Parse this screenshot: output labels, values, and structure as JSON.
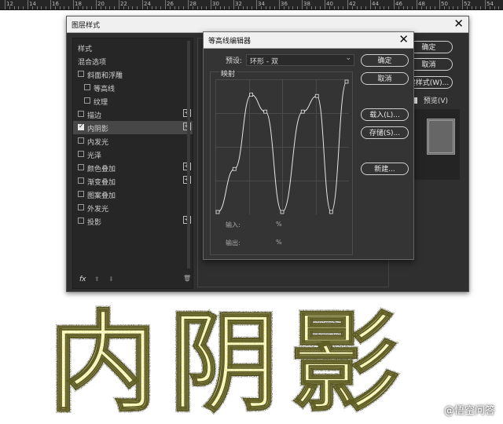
{
  "ruler": {
    "numbers": [
      "12",
      "14",
      "16",
      "18",
      "20",
      "22",
      "24",
      "26",
      "28",
      "30",
      "32",
      "34",
      "36",
      "38",
      "40",
      "42",
      "44",
      "46",
      "48",
      "50",
      "52",
      "54"
    ]
  },
  "layer_style_dialog": {
    "title": "图层样式",
    "close_glyph": "✕",
    "items": [
      {
        "label": "样式",
        "checkbox": false,
        "checked": false,
        "plus": false,
        "indent": 0
      },
      {
        "label": "混合选项",
        "checkbox": false,
        "checked": false,
        "plus": false,
        "indent": 0
      },
      {
        "label": "斜面和浮雕",
        "checkbox": true,
        "checked": false,
        "plus": false,
        "indent": 0
      },
      {
        "label": "等高线",
        "checkbox": true,
        "checked": false,
        "plus": false,
        "indent": 1
      },
      {
        "label": "纹理",
        "checkbox": true,
        "checked": false,
        "plus": false,
        "indent": 1
      },
      {
        "label": "描边",
        "checkbox": true,
        "checked": false,
        "plus": true,
        "indent": 0
      },
      {
        "label": "内阴影",
        "checkbox": true,
        "checked": true,
        "plus": true,
        "indent": 0,
        "selected": true
      },
      {
        "label": "内发光",
        "checkbox": true,
        "checked": false,
        "plus": false,
        "indent": 0
      },
      {
        "label": "光泽",
        "checkbox": true,
        "checked": false,
        "plus": false,
        "indent": 0
      },
      {
        "label": "颜色叠加",
        "checkbox": true,
        "checked": false,
        "plus": true,
        "indent": 0
      },
      {
        "label": "渐变叠加",
        "checkbox": true,
        "checked": false,
        "plus": true,
        "indent": 0
      },
      {
        "label": "图案叠加",
        "checkbox": true,
        "checked": false,
        "plus": false,
        "indent": 0
      },
      {
        "label": "外发光",
        "checkbox": true,
        "checked": false,
        "plus": false,
        "indent": 0
      },
      {
        "label": "投影",
        "checkbox": true,
        "checked": false,
        "plus": true,
        "indent": 0
      }
    ],
    "footer": {
      "fx": "fx",
      "up": "⬆",
      "down": "⬇",
      "trash": "🗑"
    },
    "buttons": {
      "ok": "确定",
      "cancel": "取消",
      "new_style": "建样式(W)..."
    },
    "preview_label": "预览(V)",
    "preview_checked": true
  },
  "contour_editor": {
    "title": "等高线编辑器",
    "close_glyph": "✕",
    "preset_label": "预设:",
    "preset_value": "环形 - 双",
    "mapping_label": "映射",
    "input_label": "输入:",
    "input_unit": "%",
    "output_label": "输出:",
    "output_unit": "%",
    "buttons": {
      "ok": "确定",
      "cancel": "取消",
      "load": "载入(L)...",
      "save": "存储(S)...",
      "new": "新建..."
    },
    "curve_points": [
      [
        0,
        0
      ],
      [
        0.13,
        0.33
      ],
      [
        0.26,
        0.9
      ],
      [
        0.37,
        0.77
      ],
      [
        0.5,
        0
      ],
      [
        0.66,
        0.77
      ],
      [
        0.77,
        0.89
      ],
      [
        0.88,
        0
      ],
      [
        1,
        1
      ]
    ]
  },
  "artwork_text": "内阴影",
  "watermark": "@悟空问答",
  "colors": {
    "accent_yellow": "#d8d400",
    "panel_bg": "#2f2f2f",
    "list_bg": "#262626",
    "titlebar": "#f0f0f0"
  }
}
